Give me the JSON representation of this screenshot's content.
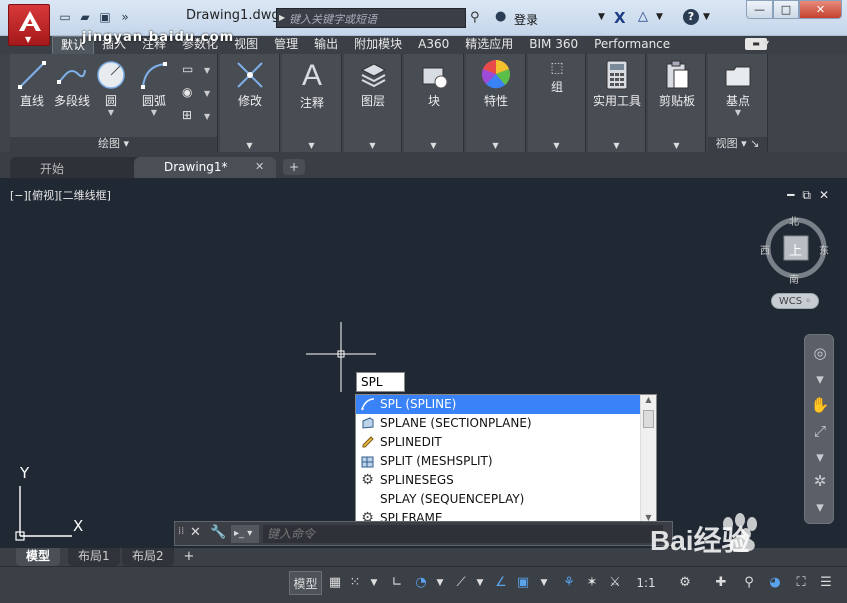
{
  "window": {
    "document_title": "Drawing1.dwg",
    "search_placeholder": "键入关键字或短语",
    "login_label": "登录",
    "help_label": "?"
  },
  "ribbon_tabs": [
    "默认",
    "插入",
    "注释",
    "参数化",
    "视图",
    "管理",
    "输出",
    "附加模块",
    "A360",
    "精选应用",
    "BIM 360",
    "Performance"
  ],
  "ribbon": {
    "draw": {
      "line": "直线",
      "polyline": "多段线",
      "circle": "圆",
      "arc": "圆弧",
      "panel_title": "绘图"
    },
    "modify": "修改",
    "annotation": "注释",
    "layers": "图层",
    "block": "块",
    "properties": "特性",
    "groups": "组",
    "utilities": "实用工具",
    "clipboard": "剪贴板",
    "basepoint": "基点",
    "view_panel_title": "视图"
  },
  "doc_tabs": {
    "start": "开始",
    "drawing": "Drawing1*"
  },
  "canvas": {
    "view_label": "[−][俯视][二维线框]",
    "dynamic_input": "SPL",
    "ucs_y": "Y",
    "ucs_x": "X"
  },
  "autocomplete": [
    {
      "label": "SPL (SPLINE)",
      "icon": "spline-icon"
    },
    {
      "label": "SPLANE (SECTIONPLANE)",
      "icon": "section-plane-icon"
    },
    {
      "label": "SPLINEDIT",
      "icon": "pencil-icon"
    },
    {
      "label": "SPLIT (MESHSPLIT)",
      "icon": "mesh-split-icon"
    },
    {
      "label": "SPLINESEGS",
      "icon": "gear-icon"
    },
    {
      "label": "SPLAY (SEQUENCEPLAY)",
      "icon": ""
    },
    {
      "label": "SPLFRAME",
      "icon": "gear-icon"
    }
  ],
  "viewcube": {
    "north": "北",
    "south": "南",
    "east": "东",
    "west": "西",
    "top": "上",
    "wcs": "WCS"
  },
  "command_line": {
    "placeholder": "键入命令"
  },
  "layout_tabs": [
    "模型",
    "布局1",
    "布局2"
  ],
  "statusbar": {
    "model": "模型",
    "scale": "1:1"
  },
  "watermark": {
    "text": "jingyan.baidu.com",
    "brand": "Bai经验"
  },
  "colors": {
    "canvas": "#202833",
    "ribbon": "#484d54",
    "selection": "#3a82f7",
    "app_red": "#c62828"
  }
}
